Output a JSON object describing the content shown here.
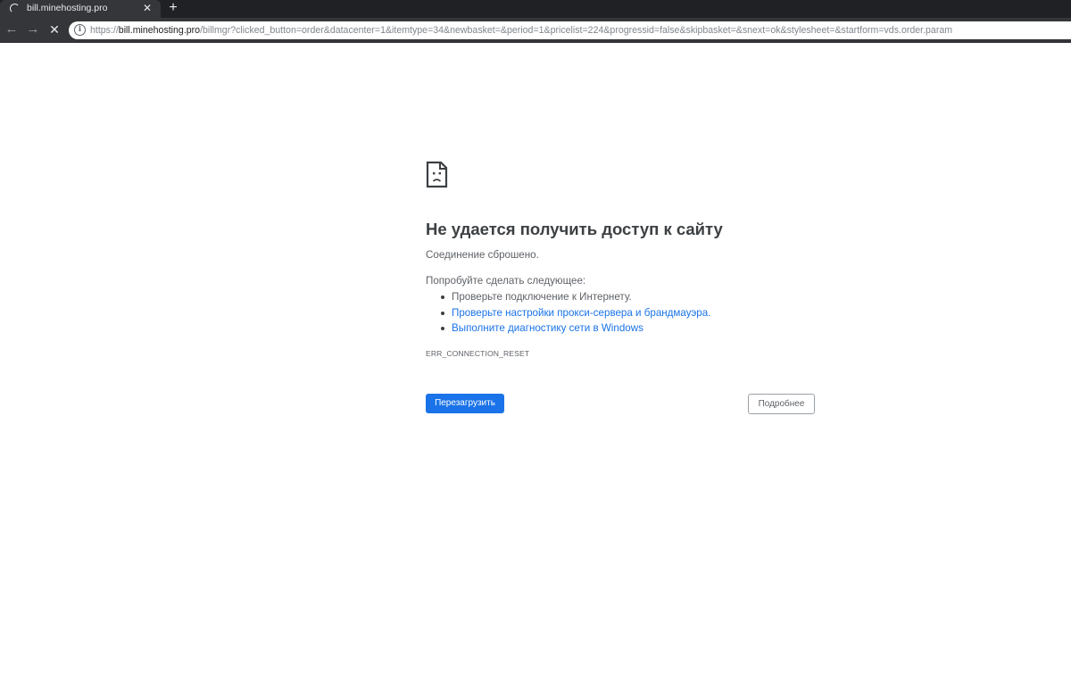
{
  "tab": {
    "title": "bill.minehosting.pro",
    "close_glyph": "✕",
    "loading_icon": "spinner-icon",
    "new_tab_glyph": "+"
  },
  "toolbar": {
    "back_glyph": "←",
    "forward_glyph": "→",
    "stop_glyph": "✕",
    "info_glyph": "i"
  },
  "address_bar": {
    "scheme": "https://",
    "host": "bill.minehosting.pro",
    "path": "/billmgr?clicked_button=order&datacenter=1&itemtype=34&newbasket=&period=1&pricelist=224&progressid=false&skipbasket=&snext=ok&stylesheet=&startform=vds.order.param"
  },
  "error_page": {
    "icon": "sad-page-icon",
    "title": "Не удается получить доступ к сайту",
    "description": "Соединение сброшено.",
    "suggestions_heading": "Попробуйте сделать следующее:",
    "suggestions": [
      {
        "label": "Проверьте подключение к Интернету.",
        "is_link": false
      },
      {
        "label": "Проверьте настройки прокси-сервера и брандмауэра.",
        "is_link": true
      },
      {
        "label": "Выполните диагностику сети в Windows",
        "is_link": true
      }
    ],
    "error_code": "ERR_CONNECTION_RESET",
    "reload_button": "Перезагрузить",
    "details_button": "Подробнее"
  },
  "colors": {
    "tabstrip_bg": "#202124",
    "toolbar_bg": "#35363a",
    "primary_button": "#1a73e8",
    "link": "#1a73e8",
    "title_text": "#3c4043",
    "body_text": "#5f6368"
  }
}
